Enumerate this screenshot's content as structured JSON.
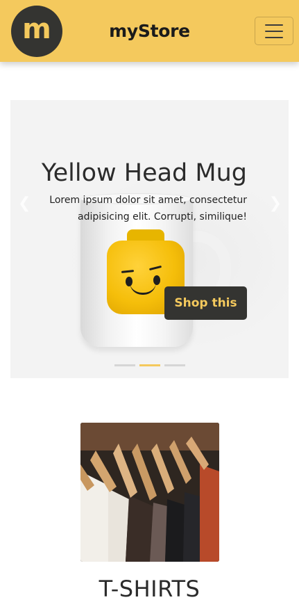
{
  "navbar": {
    "logo_letter": "m",
    "brand": "myStore",
    "menu_icon": "hamburger-icon"
  },
  "carousel": {
    "slide": {
      "title": "Yellow Head Mug",
      "text": "Lorem ipsum dolor sit amet, consectetur adipisicing elit. Corrupti, similique!",
      "button_label": "Shop this",
      "image": "yellow-lego-head-mug"
    },
    "prev_icon": "chevron-left-icon",
    "next_icon": "chevron-right-icon",
    "indicator_count": 3,
    "active_indicator": 2
  },
  "category": {
    "title": "T-SHIRTS",
    "image": "shirts-on-hangers"
  },
  "colors": {
    "brand_yellow": "#f4c95d",
    "dark": "#343431"
  }
}
